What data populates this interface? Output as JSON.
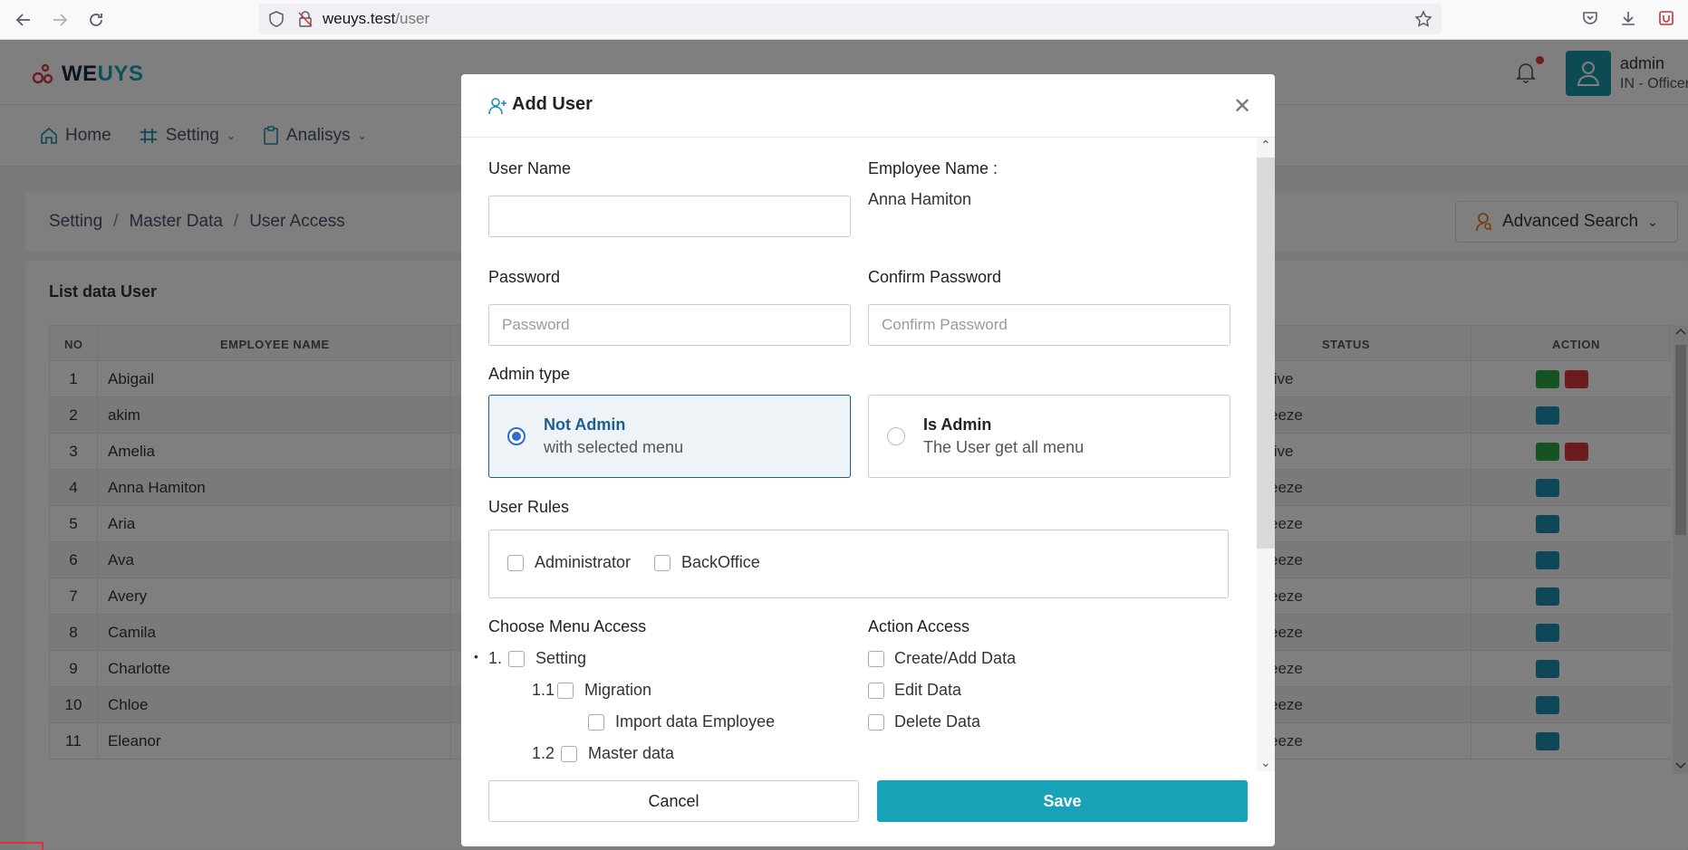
{
  "browser": {
    "url_host": "weuys.test",
    "url_path": "/user"
  },
  "app": {
    "brand_prefix": "WE",
    "brand_suffix": "UYS",
    "user": {
      "name": "admin",
      "role": "IN - Officer"
    },
    "menu": [
      {
        "label": "Home"
      },
      {
        "label": "Setting"
      },
      {
        "label": "Analisys"
      }
    ],
    "breadcrumb": [
      "Setting",
      "Master Data",
      "User Access"
    ],
    "advanced_search": "Advanced Search",
    "list_title": "List data User",
    "table": {
      "headers": {
        "no": "NO",
        "employee_name": "EMPLOYEE NAME",
        "status": "STATUS",
        "action": "ACTION"
      },
      "rows": [
        {
          "no": "1",
          "name": "Abigail",
          "status": "tive"
        },
        {
          "no": "2",
          "name": "akim",
          "status": "eeze"
        },
        {
          "no": "3",
          "name": "Amelia",
          "status": "tive"
        },
        {
          "no": "4",
          "name": "Anna Hamiton",
          "status": "eeze"
        },
        {
          "no": "5",
          "name": "Aria",
          "status": "eeze"
        },
        {
          "no": "6",
          "name": "Ava",
          "status": "eeze"
        },
        {
          "no": "7",
          "name": "Avery",
          "status": "eeze"
        },
        {
          "no": "8",
          "name": "Camila",
          "status": "eeze"
        },
        {
          "no": "9",
          "name": "Charlotte",
          "status": "eeze"
        },
        {
          "no": "10",
          "name": "Chloe",
          "status": "eeze"
        },
        {
          "no": "11",
          "name": "Eleanor",
          "status": "eeze"
        }
      ]
    }
  },
  "modal": {
    "title": "Add User",
    "user_name_label": "User Name",
    "user_name_value": "",
    "employee_name_label": "Employee Name :",
    "employee_name_value": "Anna Hamiton",
    "password_label": "Password",
    "password_placeholder": "Password",
    "confirm_password_label": "Confirm Password",
    "confirm_password_placeholder": "Confirm Password",
    "admin_type_label": "Admin type",
    "admin_types": [
      {
        "title": "Not Admin",
        "subtitle": "with selected menu",
        "selected": true
      },
      {
        "title": "Is Admin",
        "subtitle": "The User get all menu",
        "selected": false
      }
    ],
    "user_rules_label": "User Rules",
    "user_rules": [
      "Administrator",
      "BackOffice"
    ],
    "menu_access_label": "Choose Menu Access",
    "menu_access": {
      "item1_num": "1.",
      "item1_label": "Setting",
      "item11_num": "1.1",
      "item11_label": "Migration",
      "item111_label": "Import data Employee",
      "item12_num": "1.2",
      "item12_label": "Master data"
    },
    "action_access_label": "Action Access",
    "action_access": [
      "Create/Add Data",
      "Edit Data",
      "Delete Data"
    ],
    "cancel_label": "Cancel",
    "save_label": "Save"
  },
  "colors": {
    "accent": "#17a2b8",
    "selected_border": "#1b5e94",
    "active_btn": "#28a745",
    "delete_btn": "#d9363e"
  }
}
